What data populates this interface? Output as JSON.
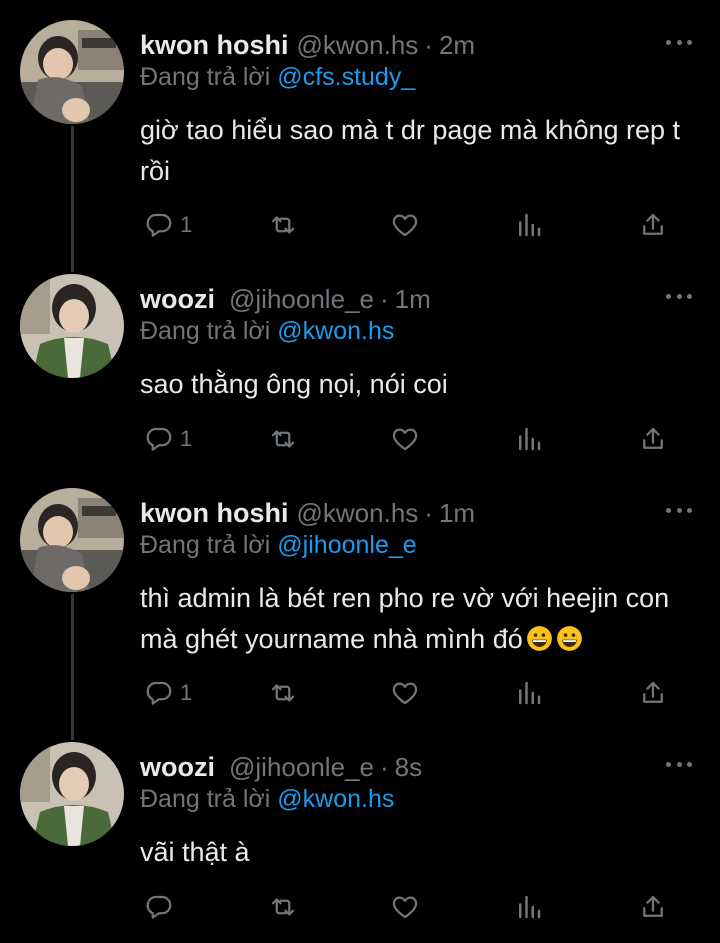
{
  "colors": {
    "background": "#000000",
    "text": "#e7e9ea",
    "secondary": "#71767b",
    "mention": "#1d9bf0",
    "thread_line": "#333639"
  },
  "tweets": [
    {
      "display_name": "kwon hoshi",
      "handle": "@kwon.hs",
      "separator": "·",
      "time": "2m",
      "replying_prefix": "Đang trả lời",
      "replying_to": "@cfs.study_",
      "text": "giờ tao hiểu sao mà t dr page mà không rep t rồi",
      "reply_count": "1",
      "avatar": "avatar-kwon-hoshi"
    },
    {
      "display_name": "woozi",
      "handle": "@jihoonle_e",
      "separator": "·",
      "time": "1m",
      "replying_prefix": "Đang trả lời",
      "replying_to": "@kwon.hs",
      "text": "sao thằng ông nọi, nói coi",
      "reply_count": "1",
      "avatar": "avatar-woozi"
    },
    {
      "display_name": "kwon hoshi",
      "handle": "@kwon.hs",
      "separator": "·",
      "time": "1m",
      "replying_prefix": "Đang trả lời",
      "replying_to": "@jihoonle_e",
      "text": "thì admin là bét ren pho re vờ với heejin con mà ghét yourname nhà mình đó",
      "emoji": [
        "grinning-face-emoji",
        "grinning-face-emoji"
      ],
      "reply_count": "1",
      "avatar": "avatar-kwon-hoshi"
    },
    {
      "display_name": "woozi",
      "handle": "@jihoonle_e",
      "separator": "·",
      "time": "8s",
      "replying_prefix": "Đang trả lời",
      "replying_to": "@kwon.hs",
      "text": "vãi thật à",
      "reply_count": "",
      "avatar": "avatar-woozi"
    }
  ],
  "icons": [
    "reply-icon",
    "retweet-icon",
    "like-icon",
    "views-icon",
    "share-icon",
    "more-icon"
  ]
}
